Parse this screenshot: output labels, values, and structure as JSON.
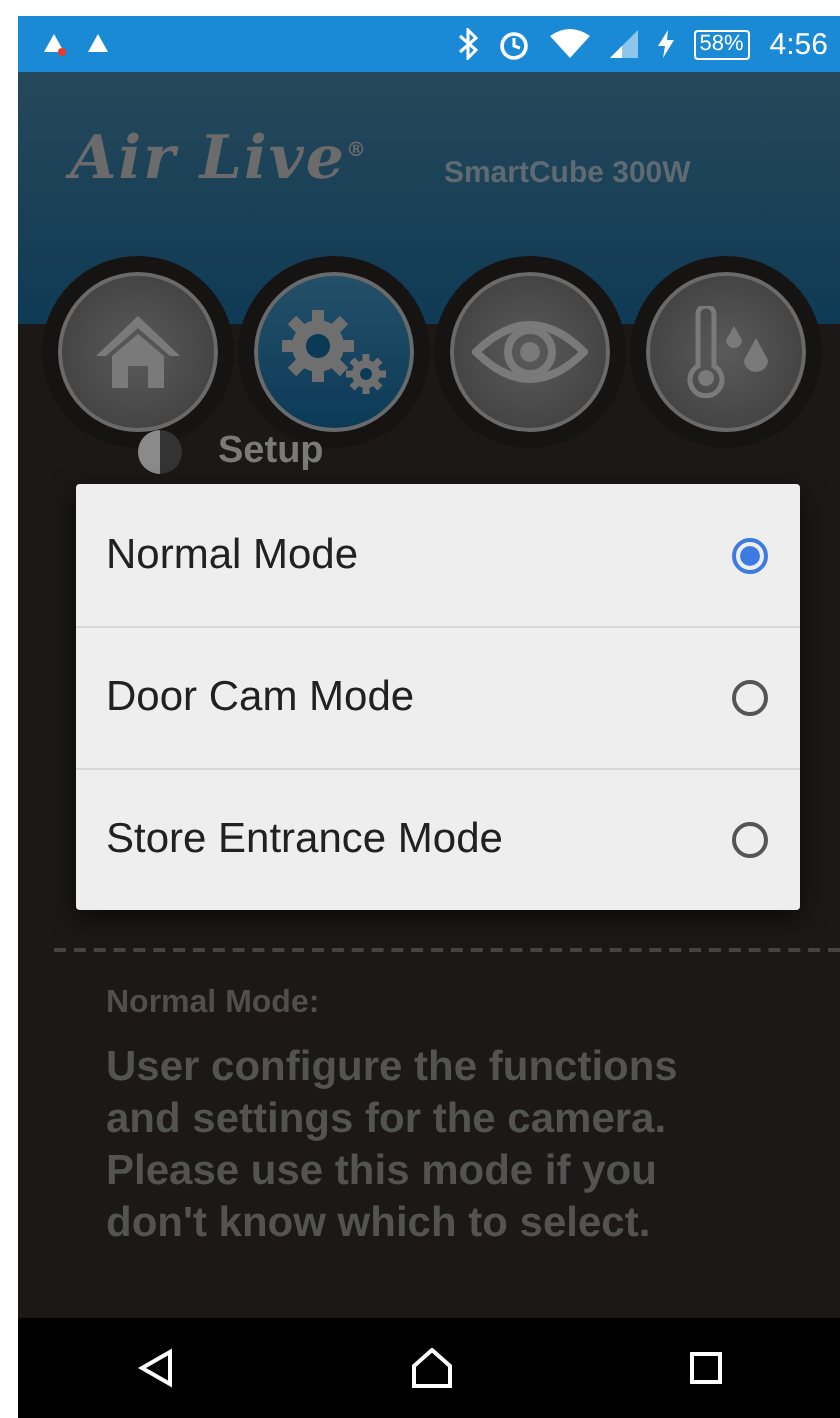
{
  "status_bar": {
    "battery": "58%",
    "time": "4:56"
  },
  "header": {
    "brand": "Air Live",
    "trademark": "®",
    "model": "SmartCube 300W"
  },
  "nav_tabs": [
    {
      "kind": "home",
      "selected": false
    },
    {
      "kind": "gears",
      "selected": true
    },
    {
      "kind": "eye",
      "selected": false
    },
    {
      "kind": "thermometer",
      "selected": false
    }
  ],
  "section": {
    "title": "Setup"
  },
  "mode_dialog": {
    "options": [
      {
        "label": "Normal Mode",
        "selected": true
      },
      {
        "label": "Door Cam Mode",
        "selected": false
      },
      {
        "label": "Store Entrance Mode",
        "selected": false
      }
    ]
  },
  "description": {
    "title": "Normal Mode:",
    "text": "User configure the functions and settings for the camera. Please use this mode if you don't know which to select."
  }
}
